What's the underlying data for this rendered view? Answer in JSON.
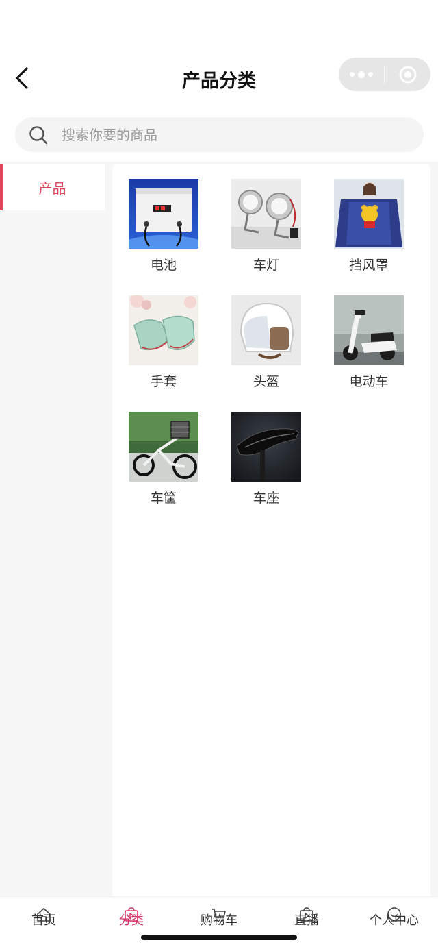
{
  "header": {
    "title": "产品分类"
  },
  "search": {
    "placeholder": "搜索你要的商品"
  },
  "sidebar": {
    "items": [
      {
        "label": "产品",
        "active": true
      }
    ]
  },
  "categories": [
    {
      "name": "电池",
      "icon": "battery-controller-photo"
    },
    {
      "name": "车灯",
      "icon": "headlight-photo"
    },
    {
      "name": "挡风罩",
      "icon": "windshield-cover-photo"
    },
    {
      "name": "手套",
      "icon": "handlebar-gloves-photo"
    },
    {
      "name": "头盔",
      "icon": "helmet-photo"
    },
    {
      "name": "电动车",
      "icon": "electric-scooter-photo"
    },
    {
      "name": "车筐",
      "icon": "bicycle-basket-photo"
    },
    {
      "name": "车座",
      "icon": "saddle-photo"
    }
  ],
  "tabbar": {
    "tabs": [
      {
        "label": "首页",
        "icon": "home-icon",
        "active": false
      },
      {
        "label": "分类",
        "icon": "category-bag-icon",
        "active": true
      },
      {
        "label": "购物车",
        "icon": "cart-icon",
        "active": false
      },
      {
        "label": "直播",
        "icon": "live-icon",
        "active": false
      },
      {
        "label": "个人中心",
        "icon": "profile-icon",
        "active": false
      }
    ]
  },
  "colors": {
    "accent": "#e2445c",
    "tab_active": "#d63a6a",
    "background": "#f7f7f7"
  }
}
